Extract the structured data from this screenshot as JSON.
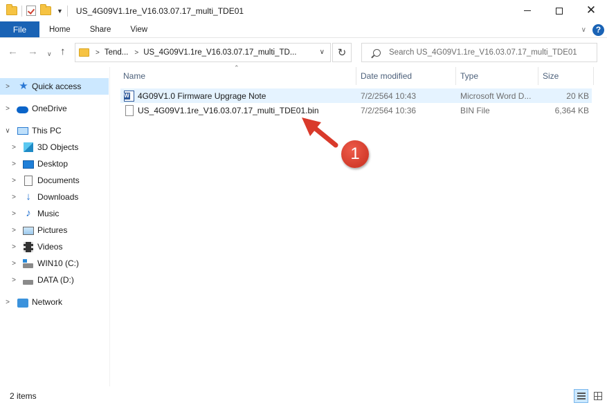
{
  "window": {
    "title": "US_4G09V1.1re_V16.03.07.17_multi_TDE01",
    "minimize": "minimize",
    "maximize": "maximize",
    "close": "close"
  },
  "ribbon": {
    "tabs": [
      "File",
      "Home",
      "Share",
      "View"
    ],
    "accent": "#1a63b5",
    "help": "?"
  },
  "address": {
    "crumbs": [
      "Tend...",
      "US_4G09V1.1re_V16.03.07.17_multi_TD..."
    ],
    "search_placeholder": "Search US_4G09V1.1re_V16.03.07.17_multi_TDE01"
  },
  "sidebar": {
    "items": [
      {
        "label": "Quick access",
        "icon": "star-icon",
        "selected": true
      },
      {
        "label": "OneDrive",
        "icon": "cloud-icon"
      },
      {
        "label": "This PC",
        "icon": "computer-icon",
        "expanded": true
      },
      {
        "label": "3D Objects",
        "icon": "cube-icon"
      },
      {
        "label": "Desktop",
        "icon": "desktop-icon"
      },
      {
        "label": "Documents",
        "icon": "document-icon"
      },
      {
        "label": "Downloads",
        "icon": "download-icon"
      },
      {
        "label": "Music",
        "icon": "music-icon"
      },
      {
        "label": "Pictures",
        "icon": "pictures-icon"
      },
      {
        "label": "Videos",
        "icon": "videos-icon"
      },
      {
        "label": "WIN10 (C:)",
        "icon": "system-drive-icon"
      },
      {
        "label": "DATA (D:)",
        "icon": "drive-icon"
      },
      {
        "label": "Network",
        "icon": "network-icon"
      }
    ]
  },
  "columns": {
    "name": "Name",
    "date": "Date modified",
    "type": "Type",
    "size": "Size"
  },
  "files": [
    {
      "name": "4G09V1.0 Firmware Upgrage Note",
      "date": "7/2/2564 10:43",
      "type": "Microsoft Word D...",
      "size": "20 KB",
      "icon": "word-document-icon",
      "selected": true
    },
    {
      "name": "US_4G09V1.1re_V16.03.07.17_multi_TDE01.bin",
      "date": "7/2/2564 10:36",
      "type": "BIN File",
      "size": "6,364 KB",
      "icon": "file-icon"
    }
  ],
  "annotation": {
    "badge": "1",
    "color": "#d93a2b"
  },
  "status": {
    "items": "2 items"
  }
}
